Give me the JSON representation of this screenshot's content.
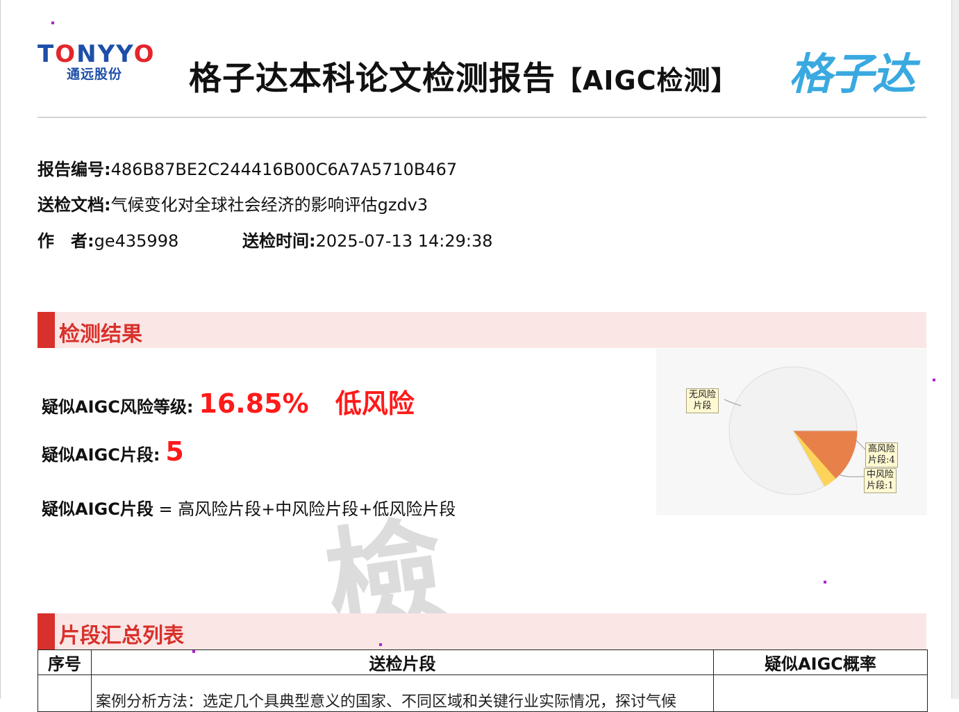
{
  "brand_left": {
    "name_a": "T",
    "name_o1": "O",
    "name_b": "NYY",
    "name_o2": "O",
    "sub": "通远股份"
  },
  "title": {
    "main": "格子达本科论文检测报告",
    "suffix": "【AIGC检测】"
  },
  "brand_right": "格子达",
  "meta": {
    "report_no_label": "报告编号:",
    "report_no": "486B87BE2C244416B00C6A7A5710B467",
    "doc_label": "送检文档:",
    "doc": "气候变化对全球社会经济的影响评估gzdv3",
    "author_label": "作　者:",
    "author": "ge435998",
    "time_label": "送检时间:",
    "time": "2025-07-13 14:29:38"
  },
  "watermark": "檢",
  "section_results": "检测结果",
  "results": {
    "risk_label": "疑似AIGC风险等级:",
    "risk_pct": "16.85%",
    "risk_level": "低风险",
    "seg_label": "疑似AIGC片段:",
    "seg_count": "5",
    "formula_label": "疑似AIGC片段",
    "formula": " = 高风险片段+中风险片段+低风险片段"
  },
  "chart_data": {
    "type": "pie",
    "slices": [
      {
        "label_l1": "无风险",
        "label_l2": "片段",
        "share": 0.8315,
        "color": "#f2f2f2"
      },
      {
        "label_l1": "高风险",
        "label_l2": "片段:4",
        "share": 0.1348,
        "color": "#e8804a"
      },
      {
        "label_l1": "中风险",
        "label_l2": "片段:1",
        "share": 0.0337,
        "color": "#fdd35a"
      }
    ]
  },
  "section_list": "片段汇总列表",
  "table": {
    "headers": [
      "序号",
      "送检片段",
      "疑似AIGC概率"
    ],
    "row1_cut": "案例分析方法：选定几个具典型意义的国家、不同区域和关键行业实际情况，探讨气候"
  }
}
